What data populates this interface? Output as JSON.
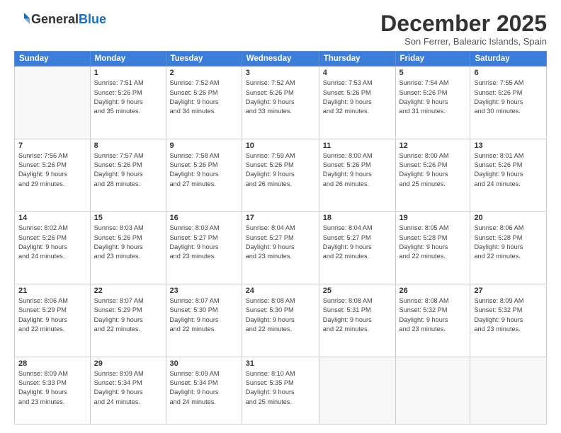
{
  "logo": {
    "general": "General",
    "blue": "Blue"
  },
  "header": {
    "month_title": "December 2025",
    "location": "Son Ferrer, Balearic Islands, Spain"
  },
  "days_of_week": [
    "Sunday",
    "Monday",
    "Tuesday",
    "Wednesday",
    "Thursday",
    "Friday",
    "Saturday"
  ],
  "weeks": [
    [
      {
        "day": "",
        "info": ""
      },
      {
        "day": "1",
        "info": "Sunrise: 7:51 AM\nSunset: 5:26 PM\nDaylight: 9 hours\nand 35 minutes."
      },
      {
        "day": "2",
        "info": "Sunrise: 7:52 AM\nSunset: 5:26 PM\nDaylight: 9 hours\nand 34 minutes."
      },
      {
        "day": "3",
        "info": "Sunrise: 7:52 AM\nSunset: 5:26 PM\nDaylight: 9 hours\nand 33 minutes."
      },
      {
        "day": "4",
        "info": "Sunrise: 7:53 AM\nSunset: 5:26 PM\nDaylight: 9 hours\nand 32 minutes."
      },
      {
        "day": "5",
        "info": "Sunrise: 7:54 AM\nSunset: 5:26 PM\nDaylight: 9 hours\nand 31 minutes."
      },
      {
        "day": "6",
        "info": "Sunrise: 7:55 AM\nSunset: 5:26 PM\nDaylight: 9 hours\nand 30 minutes."
      }
    ],
    [
      {
        "day": "7",
        "info": "Sunrise: 7:56 AM\nSunset: 5:26 PM\nDaylight: 9 hours\nand 29 minutes."
      },
      {
        "day": "8",
        "info": "Sunrise: 7:57 AM\nSunset: 5:26 PM\nDaylight: 9 hours\nand 28 minutes."
      },
      {
        "day": "9",
        "info": "Sunrise: 7:58 AM\nSunset: 5:26 PM\nDaylight: 9 hours\nand 27 minutes."
      },
      {
        "day": "10",
        "info": "Sunrise: 7:59 AM\nSunset: 5:26 PM\nDaylight: 9 hours\nand 26 minutes."
      },
      {
        "day": "11",
        "info": "Sunrise: 8:00 AM\nSunset: 5:26 PM\nDaylight: 9 hours\nand 26 minutes."
      },
      {
        "day": "12",
        "info": "Sunrise: 8:00 AM\nSunset: 5:26 PM\nDaylight: 9 hours\nand 25 minutes."
      },
      {
        "day": "13",
        "info": "Sunrise: 8:01 AM\nSunset: 5:26 PM\nDaylight: 9 hours\nand 24 minutes."
      }
    ],
    [
      {
        "day": "14",
        "info": "Sunrise: 8:02 AM\nSunset: 5:26 PM\nDaylight: 9 hours\nand 24 minutes."
      },
      {
        "day": "15",
        "info": "Sunrise: 8:03 AM\nSunset: 5:26 PM\nDaylight: 9 hours\nand 23 minutes."
      },
      {
        "day": "16",
        "info": "Sunrise: 8:03 AM\nSunset: 5:27 PM\nDaylight: 9 hours\nand 23 minutes."
      },
      {
        "day": "17",
        "info": "Sunrise: 8:04 AM\nSunset: 5:27 PM\nDaylight: 9 hours\nand 23 minutes."
      },
      {
        "day": "18",
        "info": "Sunrise: 8:04 AM\nSunset: 5:27 PM\nDaylight: 9 hours\nand 22 minutes."
      },
      {
        "day": "19",
        "info": "Sunrise: 8:05 AM\nSunset: 5:28 PM\nDaylight: 9 hours\nand 22 minutes."
      },
      {
        "day": "20",
        "info": "Sunrise: 8:06 AM\nSunset: 5:28 PM\nDaylight: 9 hours\nand 22 minutes."
      }
    ],
    [
      {
        "day": "21",
        "info": "Sunrise: 8:06 AM\nSunset: 5:29 PM\nDaylight: 9 hours\nand 22 minutes."
      },
      {
        "day": "22",
        "info": "Sunrise: 8:07 AM\nSunset: 5:29 PM\nDaylight: 9 hours\nand 22 minutes."
      },
      {
        "day": "23",
        "info": "Sunrise: 8:07 AM\nSunset: 5:30 PM\nDaylight: 9 hours\nand 22 minutes."
      },
      {
        "day": "24",
        "info": "Sunrise: 8:08 AM\nSunset: 5:30 PM\nDaylight: 9 hours\nand 22 minutes."
      },
      {
        "day": "25",
        "info": "Sunrise: 8:08 AM\nSunset: 5:31 PM\nDaylight: 9 hours\nand 22 minutes."
      },
      {
        "day": "26",
        "info": "Sunrise: 8:08 AM\nSunset: 5:32 PM\nDaylight: 9 hours\nand 23 minutes."
      },
      {
        "day": "27",
        "info": "Sunrise: 8:09 AM\nSunset: 5:32 PM\nDaylight: 9 hours\nand 23 minutes."
      }
    ],
    [
      {
        "day": "28",
        "info": "Sunrise: 8:09 AM\nSunset: 5:33 PM\nDaylight: 9 hours\nand 23 minutes."
      },
      {
        "day": "29",
        "info": "Sunrise: 8:09 AM\nSunset: 5:34 PM\nDaylight: 9 hours\nand 24 minutes."
      },
      {
        "day": "30",
        "info": "Sunrise: 8:09 AM\nSunset: 5:34 PM\nDaylight: 9 hours\nand 24 minutes."
      },
      {
        "day": "31",
        "info": "Sunrise: 8:10 AM\nSunset: 5:35 PM\nDaylight: 9 hours\nand 25 minutes."
      },
      {
        "day": "",
        "info": ""
      },
      {
        "day": "",
        "info": ""
      },
      {
        "day": "",
        "info": ""
      }
    ]
  ]
}
